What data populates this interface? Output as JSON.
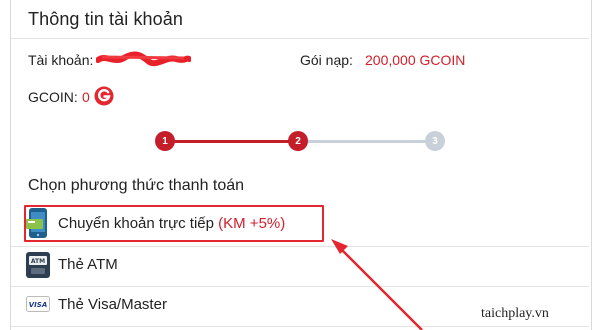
{
  "header": {
    "title": "Thông tin tài khoản"
  },
  "account": {
    "account_label": "Tài khoản:",
    "package_label": "Gói nạp:",
    "package_value": "200,000 GCOIN",
    "gcoin_label": "GCOIN:",
    "gcoin_value": "0"
  },
  "stepper": {
    "steps": [
      "1",
      "2",
      "3"
    ],
    "current_step": 2,
    "active_color": "#c41e2a",
    "inactive_color": "#c8d1da"
  },
  "payment": {
    "section_title": "Chọn phương thức thanh toán",
    "methods": [
      {
        "label": "Chuyển khoản trực tiếp",
        "promo": "(KM +5%)",
        "icon": "bank-transfer-icon"
      },
      {
        "label": "Thẻ ATM",
        "icon": "atm-card-icon"
      },
      {
        "label": "Thẻ Visa/Master",
        "icon": "visa-card-icon"
      }
    ]
  },
  "watermark": "taichplay.vn",
  "colors": {
    "accent": "#d0202a",
    "highlight_border": "#e3262f"
  }
}
